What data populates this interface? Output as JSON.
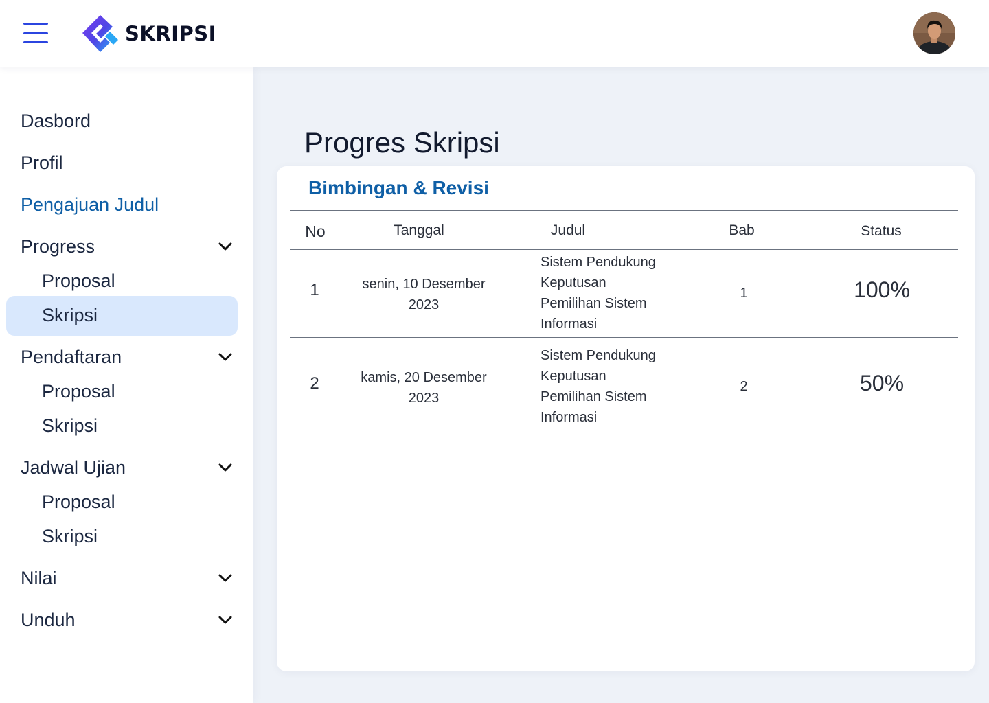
{
  "header": {
    "logo_text": "SKRIPSI",
    "menu_icon": "hamburger-menu-icon",
    "avatar_icon": "user-avatar"
  },
  "sidebar": {
    "items": [
      {
        "label": "Dasbord"
      },
      {
        "label": "Profil"
      },
      {
        "label": "Pengajuan Judul"
      },
      {
        "label": "Progress",
        "sub": [
          "Proposal",
          "Skripsi"
        ]
      },
      {
        "label": "Pendaftaran",
        "sub": [
          "Proposal",
          "Skripsi"
        ]
      },
      {
        "label": "Jadwal Ujian",
        "sub": [
          "Proposal",
          "Skripsi"
        ]
      },
      {
        "label": "Nilai"
      },
      {
        "label": "Unduh"
      }
    ],
    "active": "Progress / Skripsi"
  },
  "main": {
    "title": "Progres Skripsi",
    "card_title": "Bimbingan & Revisi",
    "columns": [
      "No",
      "Tanggal",
      "Judul",
      "Bab",
      "Status"
    ],
    "rows": [
      {
        "no": "1",
        "tanggal_1": "senin, 10 Desember",
        "tanggal_2": "2023",
        "judul": [
          "Sistem Pendukung",
          "Keputusan",
          "Pemilihan Sistem",
          "Informasi"
        ],
        "bab": "1",
        "status": "100%"
      },
      {
        "no": "2",
        "tanggal_1": "kamis, 20 Desember",
        "tanggal_2": "2023",
        "judul": [
          "Sistem Pendukung",
          "Keputusan",
          "Pemilihan Sistem",
          "Informasi"
        ],
        "bab": "2",
        "status": "50%"
      }
    ]
  },
  "colors": {
    "accent_blue": "#2b45e0",
    "link_blue": "#0f5fa6",
    "active_bg": "#d9e8fd",
    "page_bg": "#eef2f8"
  }
}
